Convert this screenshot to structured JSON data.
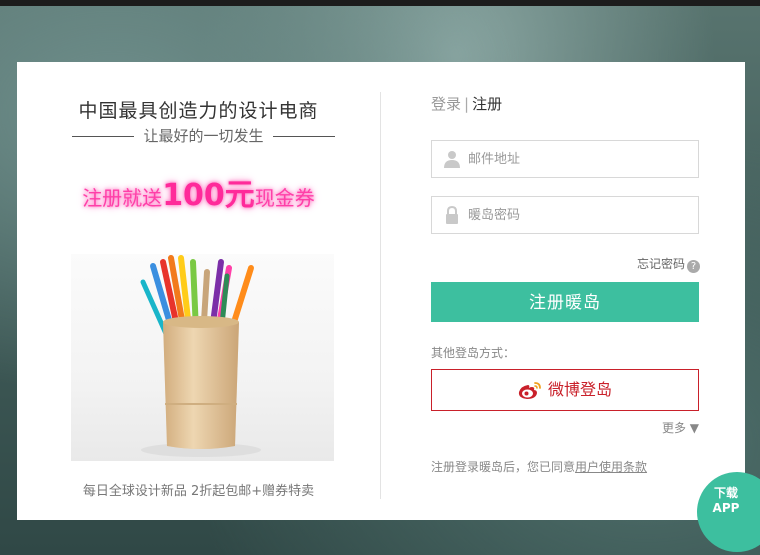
{
  "left": {
    "headline": "中国最具创造力的设计电商",
    "subheadline": "让最好的一切发生",
    "promo": {
      "prefix": "注册就送",
      "amount": "100元",
      "suffix": "现金券"
    },
    "tagline": "每日全球设计新品 2折起包邮+赠券特卖"
  },
  "tabs": {
    "login": "登录",
    "separator": "|",
    "register": "注册"
  },
  "form": {
    "email_placeholder": "邮件地址",
    "password_placeholder": "暖岛密码",
    "forgot_label": "忘记密码",
    "forgot_help": "?",
    "submit_label": "注册暖岛"
  },
  "social": {
    "other_label": "其他登岛方式：",
    "weibo_label": "微博登岛",
    "more_label": "更多 ▼"
  },
  "terms": {
    "prefix": "注册登录暖岛后，您已同意",
    "link": "用户使用条款"
  },
  "app_badge": {
    "line1": "下载",
    "line2": "APP"
  },
  "colors": {
    "accent": "#3dbf9f",
    "weibo": "#c9202a",
    "promo": "#ff3fa8"
  }
}
